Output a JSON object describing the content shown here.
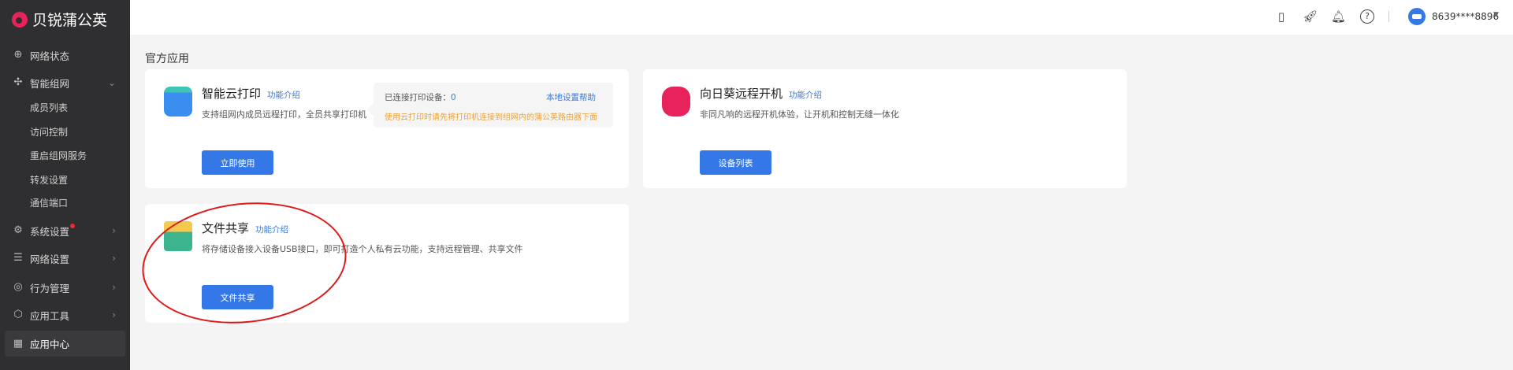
{
  "brand": "贝锐蒲公英",
  "sidebar": {
    "items": [
      {
        "label": "网络状态",
        "icon": "globe-icon"
      },
      {
        "label": "智能组网",
        "icon": "network-icon",
        "expanded": true
      },
      {
        "label": "成员列表"
      },
      {
        "label": "访问控制"
      },
      {
        "label": "重启组网服务"
      },
      {
        "label": "转发设置"
      },
      {
        "label": "通信端口"
      },
      {
        "label": "系统设置",
        "icon": "gear-icon",
        "badge": true
      },
      {
        "label": "网络设置",
        "icon": "sliders-icon"
      },
      {
        "label": "行为管理",
        "icon": "behavior-icon"
      },
      {
        "label": "应用工具",
        "icon": "tools-icon"
      },
      {
        "label": "应用中心",
        "icon": "apps-icon",
        "active": true
      }
    ]
  },
  "header": {
    "username": "8639****8896"
  },
  "main": {
    "section_title": "官方应用",
    "cards": [
      {
        "title": "智能云打印",
        "intro": "功能介绍",
        "desc": "支持组网内成员远程打印，全员共享打印机",
        "button": "立即使用",
        "tip": {
          "connected_label": "已连接打印设备：",
          "connected_count": "0",
          "help": "本地设置帮助",
          "warning": "使用云打印时请先将打印机连接到组网内的蒲公英路由器下面"
        }
      },
      {
        "title": "向日葵远程开机",
        "intro": "功能介绍",
        "desc": "非同凡响的远程开机体验，让开机和控制无缝一体化",
        "button": "设备列表"
      },
      {
        "title": "文件共享",
        "intro": "功能介绍",
        "desc": "将存储设备接入设备USB接口，即可打造个人私有云功能，支持远程管理、共享文件",
        "button": "文件共享"
      }
    ]
  },
  "colors": {
    "accent": "#3478e8",
    "sidebar": "#2f2f31",
    "warning": "#e8a23a",
    "annotation": "#e01818"
  }
}
